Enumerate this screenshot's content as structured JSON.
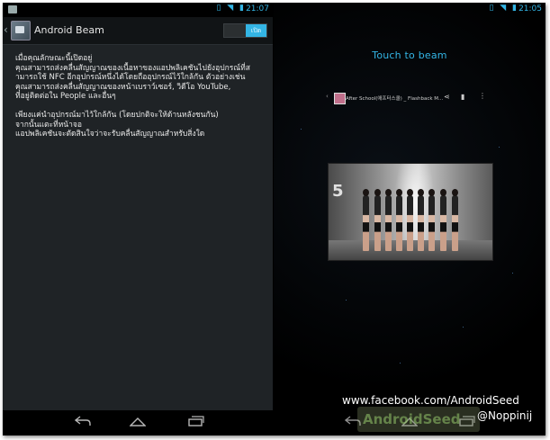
{
  "left": {
    "status_time": "21:07",
    "status_icons": "▯ ◥ ▮",
    "actionbar": {
      "title": "Android Beam",
      "toggle_on_label": "เปิด"
    },
    "paragraphs": [
      [
        "เมื่อคุณลักษณะนี้เปิดอยู่",
        "คุณสามารถส่งคลื่นสัญญาณของเนื้อหาของแอปพลิเคชันไปยังอุปกรณ์ที่ส",
        "ามารถใช้ NFC อีกอุปกรณ์หนึ่งได้โดยถืออุปกรณ์ไว้ใกล้กัน ตัวอย่างเช่น",
        "คุณสามารถส่งคลื่นสัญญาณของหน้าเบราว์เซอร์, วิดีโอ YouTube,",
        "ที่อยู่ติดต่อใน People และอื่นๆ"
      ],
      [
        "เพียงแค่นำอุปกรณ์มาไว้ใกล้กัน (โดยปกติจะให้ด้านหลังชนกัน)",
        "จากนั้นแตะที่หน้าจอ",
        "แอปพลิเคชันจะตัดสินใจว่าจะรับคลื่นสัญญาณสำหรับสิ่งใด"
      ]
    ],
    "nav_icons": [
      "back-icon",
      "home-icon",
      "recents-icon"
    ]
  },
  "right": {
    "status_time": "21:05",
    "status_icons": "▯ ◥ ▮",
    "touch_to_beam": "Touch to beam",
    "notification_text": "After School(애프터스쿨) _ Flashback M...",
    "nav_icons": [
      "back-icon",
      "home-icon",
      "recents-icon"
    ]
  },
  "overlay": {
    "facebook": "www.facebook.com/AndroidSeed",
    "handle": "@Noppinij",
    "watermark": "AndroidSeed"
  },
  "colors": {
    "accent": "#33b5e5",
    "content_bg": "#1f2326"
  }
}
